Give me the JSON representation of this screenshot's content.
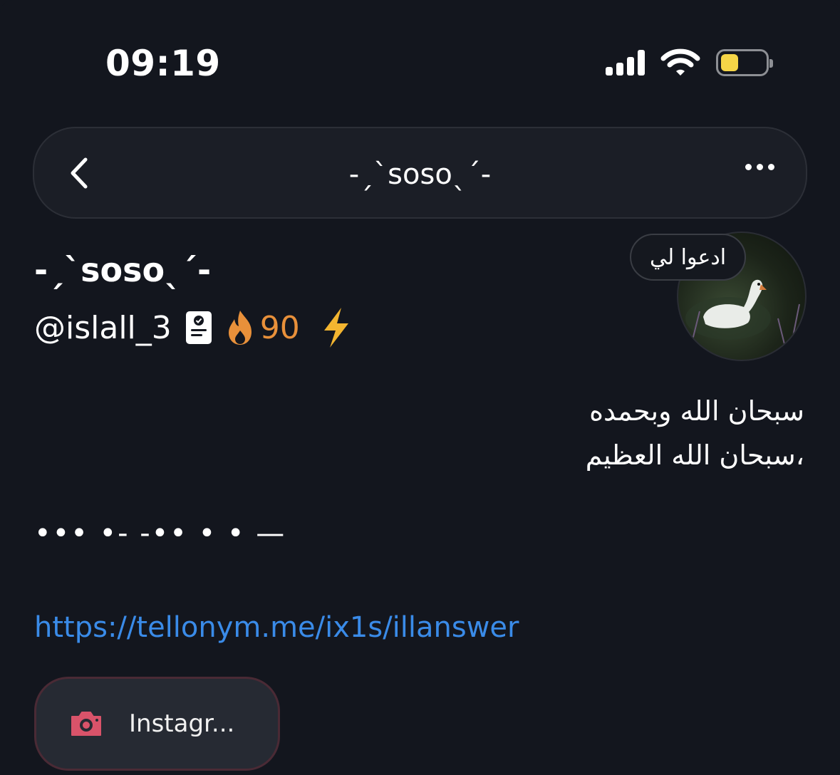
{
  "status_bar": {
    "time": "09:19",
    "battery_color": "#f5d547"
  },
  "nav": {
    "title": "-ˏˋsosoˎˊ-",
    "back_icon": "chevron-left-icon",
    "more_icon": "more-horizontal-icon"
  },
  "profile": {
    "display_name": "-ˏˋsosoˎˊ-",
    "handle": "@islall_3",
    "streak_count": "90",
    "streak_color": "#e8903a",
    "status_bubble": "ادعوا لي",
    "bio_line1": "سبحان الله وبحمده",
    "bio_line2": "،سبحان الله العظيم",
    "bio_morse": "••• •- -•• • • —",
    "link": "https://tellonym.me/ix1s/illanswer",
    "link_color": "#3a8be8"
  },
  "social": {
    "label": "Instagr...",
    "icon": "camera-icon",
    "icon_color": "#d9536a"
  }
}
